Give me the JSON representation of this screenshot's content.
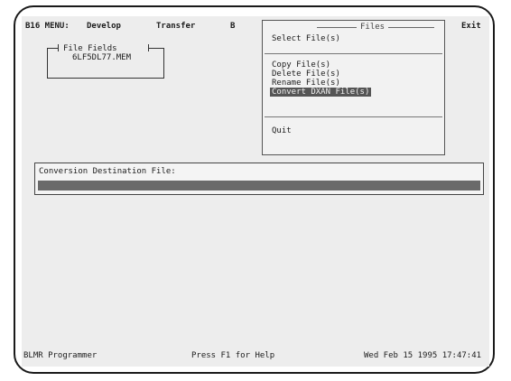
{
  "menubar": {
    "app_label": "B16 MENU:",
    "items": [
      "Develop",
      "Transfer",
      "B",
      "Exit"
    ]
  },
  "file_field": {
    "title": "File Fields",
    "filename": "6LF5DL77.MEM"
  },
  "dropdown": {
    "title": "Files",
    "items": [
      "Select File(s)",
      "Copy File(s)",
      "Delete File(s)",
      "Rename File(s)",
      "Convert DXAN File(s)",
      "Quit"
    ],
    "selected_index": 4
  },
  "conversion": {
    "label": "Conversion Destination File:",
    "value": ""
  },
  "statusbar": {
    "left": "BLMR Programmer",
    "center": "Press F1 for Help",
    "right": "Wed Feb 15 1995 17:47:41"
  }
}
